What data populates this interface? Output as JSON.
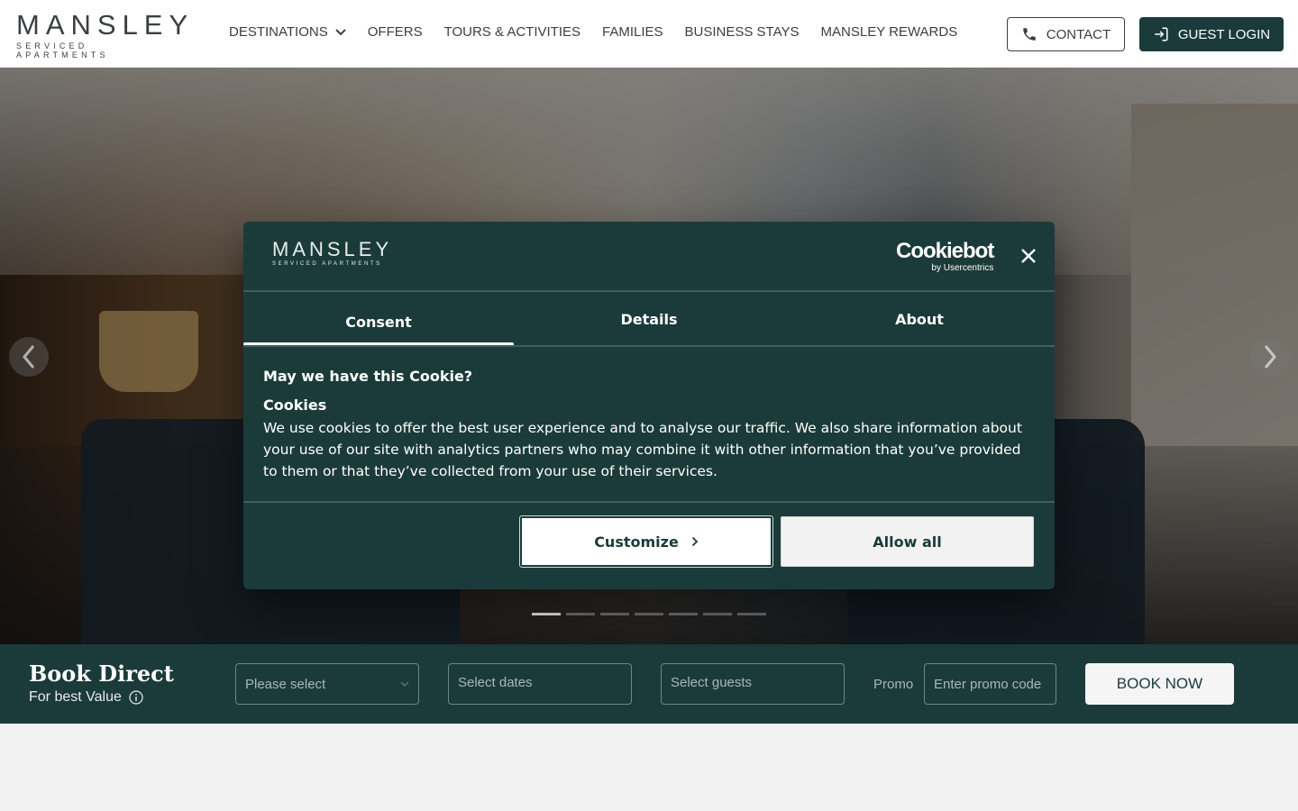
{
  "brand": {
    "name": "MANSLEY",
    "tagline": "SERVICED APARTMENTS"
  },
  "nav": {
    "items": [
      {
        "label": "DESTINATIONS",
        "has_dropdown": true
      },
      {
        "label": "OFFERS"
      },
      {
        "label": "TOURS & ACTIVITIES"
      },
      {
        "label": "FAMILIES"
      },
      {
        "label": "BUSINESS STAYS"
      },
      {
        "label": "MANSLEY REWARDS"
      }
    ],
    "contact_label": "CONTACT",
    "login_label": "GUEST LOGIN"
  },
  "hero": {
    "slide_count": 7,
    "active_slide": 1
  },
  "booking": {
    "title": "Book Direct",
    "subtitle": "For best Value",
    "property_placeholder": "Please select",
    "dates_placeholder": "Select dates",
    "guests_placeholder": "Select guests",
    "promo_label": "Promo",
    "promo_placeholder": "Enter promo code",
    "book_label": "BOOK NOW"
  },
  "cookie_dialog": {
    "brand": "MANSLEY",
    "brand_tagline": "SERVICED APARTMENTS",
    "provider": "Cookiebot",
    "provider_sub": "by Usercentrics",
    "tabs": [
      {
        "label": "Consent",
        "active": true
      },
      {
        "label": "Details",
        "active": false
      },
      {
        "label": "About",
        "active": false
      }
    ],
    "question": "May we have this Cookie?",
    "heading": "Cookies",
    "body": "We use cookies to offer the best user experience and to analyse our traffic. We also share information about your use of our site with analytics partners who may combine it with other information that you’ve provided to them or that they’ve collected from your use of their services.",
    "customize_label": "Customize",
    "allow_label": "Allow all"
  },
  "colors": {
    "brand_dark": "#1b3b3a",
    "text_dark": "#3a3f42",
    "white": "#ffffff"
  },
  "icons": {
    "contact": "phone-icon",
    "login": "login-icon",
    "close": "close-icon",
    "info": "info-icon",
    "prev": "chevron-left-icon",
    "next": "chevron-right-icon"
  }
}
